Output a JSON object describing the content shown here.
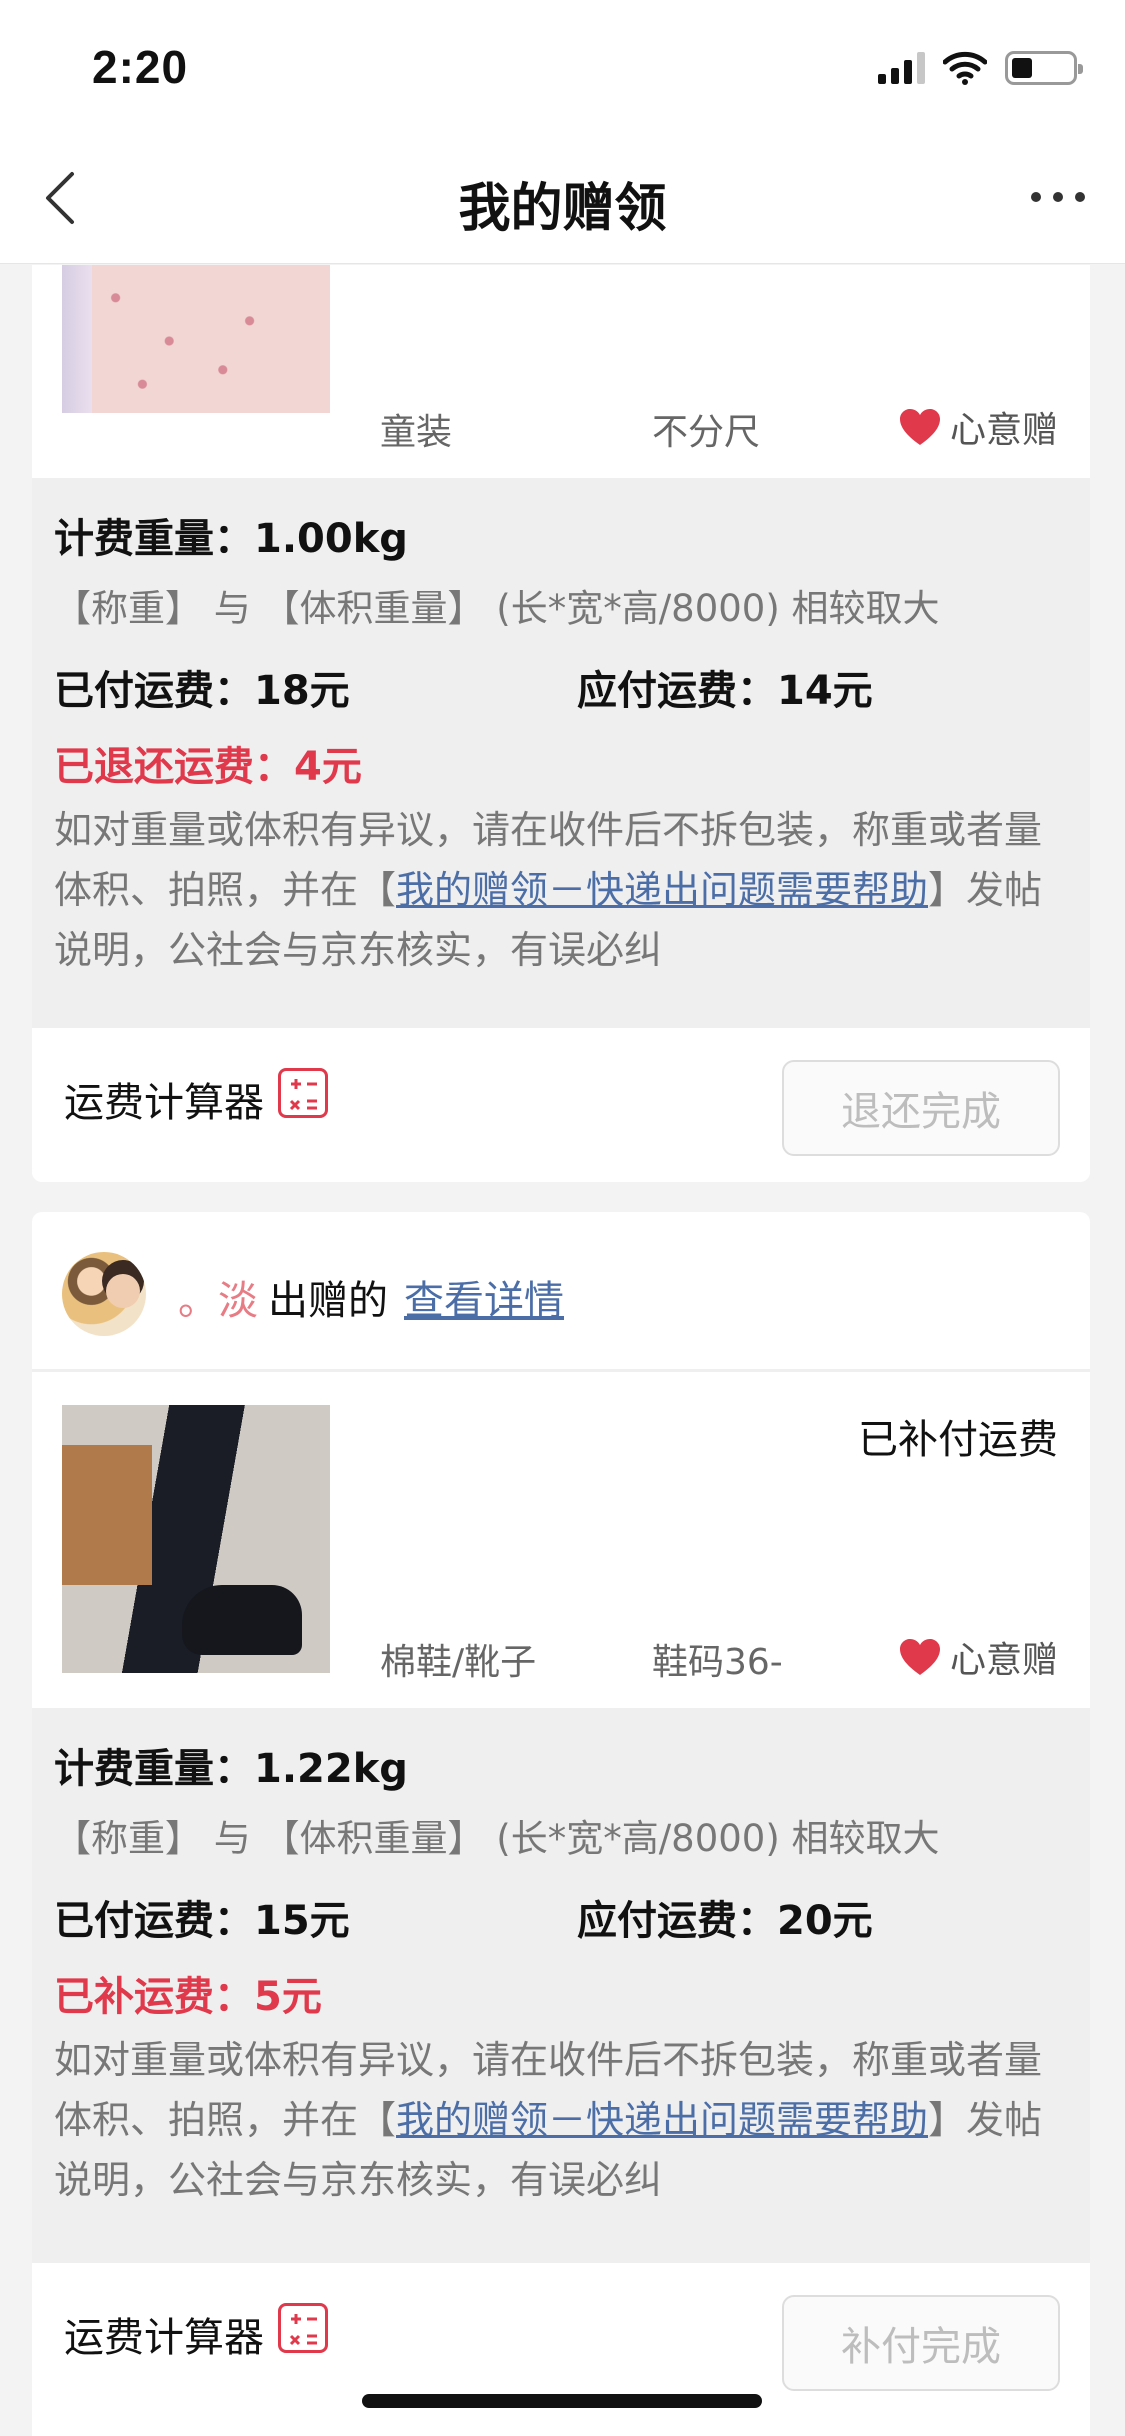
{
  "status_bar": {
    "time": "2:20"
  },
  "nav": {
    "title": "我的赠领"
  },
  "cards": [
    {
      "product": {
        "category": "童装",
        "size": "不分尺",
        "tag": "心意赠"
      },
      "weight": "计费重量：1.00kg",
      "note": "【称重】 与 【体积重量】 (长*宽*高/8000) 相较取大",
      "paid": "已付运费：18元",
      "due": "应付运费：14元",
      "adjust": "已退还运费：4元",
      "desc_pre": "如对重量或体积有异议，请在收件后不拆包装，称重或者量体积、拍照，并在【",
      "desc_link": "我的赠领－快递出问题需要帮助",
      "desc_post": "】发帖说明，公社会与京东核实，有误必纠",
      "calc_label": "运费计算器",
      "button": "退还完成"
    },
    {
      "donor": {
        "name": "。淡",
        "suffix": "出赠的",
        "link": "查看详情"
      },
      "status": "已补付运费",
      "product": {
        "category": "棉鞋/靴子",
        "size": "鞋码36-",
        "tag": "心意赠"
      },
      "weight": "计费重量：1.22kg",
      "note": "【称重】 与 【体积重量】 (长*宽*高/8000) 相较取大",
      "paid": "已付运费：15元",
      "due": "应付运费：20元",
      "adjust": "已补运费：5元",
      "desc_pre": "如对重量或体积有异议，请在收件后不拆包装，称重或者量体积、拍照，并在【",
      "desc_link": "我的赠领－快递出问题需要帮助",
      "desc_post": "】发帖说明，公社会与京东核实，有误必纠",
      "calc_label": "运费计算器",
      "button": "补付完成"
    }
  ],
  "colors": {
    "accent_red": "#e0394c",
    "link_blue": "#4c6ea7",
    "donor_pink": "#e87c85"
  },
  "icons": [
    "back-icon",
    "more-icon",
    "heart-icon",
    "calculator-icon",
    "signal-icon",
    "wifi-icon",
    "battery-icon"
  ]
}
